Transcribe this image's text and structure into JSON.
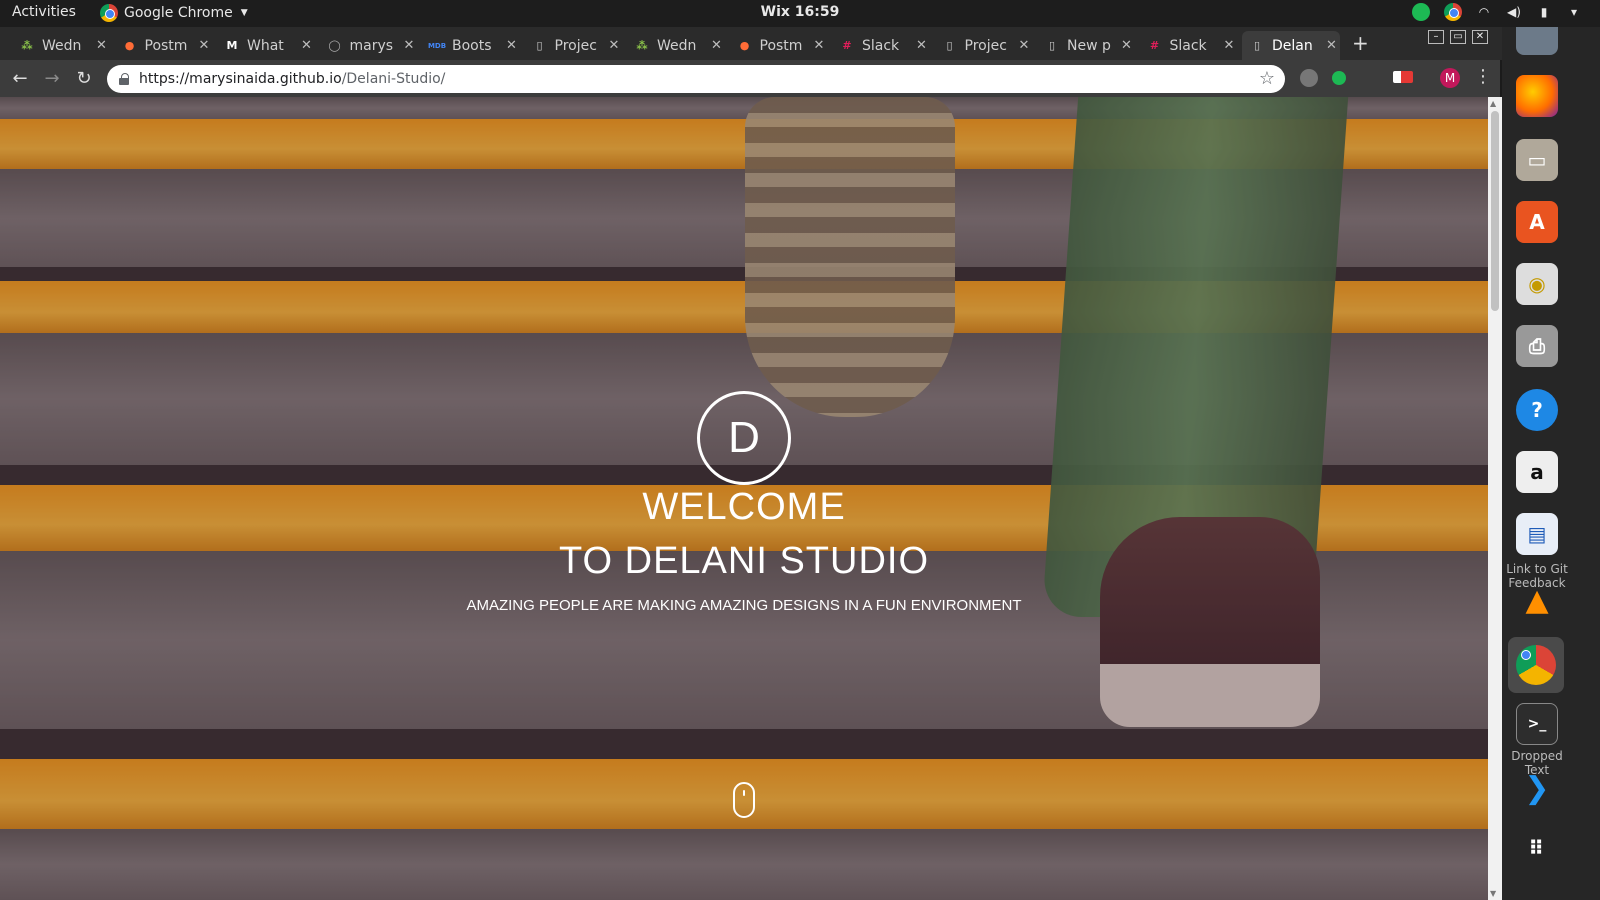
{
  "topbar": {
    "activities": "Activities",
    "app_name": "Google Chrome",
    "clock": "Wix 16:59"
  },
  "tabs": [
    {
      "label": "Wedn",
      "favicon": "leaf-icon"
    },
    {
      "label": "Postm",
      "favicon": "postman-icon"
    },
    {
      "label": "What",
      "favicon": "medium-icon"
    },
    {
      "label": "marys",
      "favicon": "github-icon"
    },
    {
      "label": "Boots",
      "favicon": "mdb-icon"
    },
    {
      "label": "Projec",
      "favicon": "page-icon"
    },
    {
      "label": "Wedn",
      "favicon": "leaf-icon"
    },
    {
      "label": "Postm",
      "favicon": "postman-icon"
    },
    {
      "label": "Slack",
      "favicon": "slack-icon"
    },
    {
      "label": "Projec",
      "favicon": "page-icon"
    },
    {
      "label": "New p",
      "favicon": "page-icon"
    },
    {
      "label": "Slack",
      "favicon": "slack-icon"
    },
    {
      "label": "Delan",
      "favicon": "page-icon",
      "active": true
    }
  ],
  "omnibox": {
    "url_host": "https://marysinaida.github.io",
    "url_path": "/Delani-Studio/"
  },
  "avatar_letter": "M",
  "hero": {
    "logo_letter": "D",
    "title_line1": "WELCOME",
    "title_line2": "TO DELANI STUDIO",
    "subtitle": "AMAZING PEOPLE ARE MAKING AMAZING DESIGNS IN A FUN ENVIRONMENT"
  },
  "dock": {
    "captions": [
      "Link to Git Feedback",
      "Dropped Text"
    ]
  },
  "colors": {
    "accent_orange": "#f39c12",
    "leg_green": "#5c8f5a"
  }
}
